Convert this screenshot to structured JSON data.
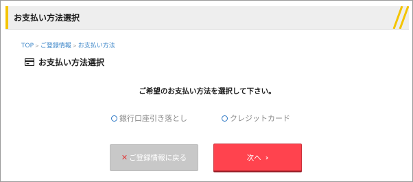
{
  "header": {
    "title": "お支払い方法選択"
  },
  "breadcrumb": {
    "items": [
      "TOP",
      "ご登録情報",
      "お支払い方法"
    ],
    "separator": ">"
  },
  "section": {
    "title": "お支払い方法選択",
    "icon": "credit-card-icon"
  },
  "instruction": "ご希望のお支払い方法を選択して下さい。",
  "payment_options": [
    {
      "label": "銀行口座引き落とし",
      "selected": false
    },
    {
      "label": "クレジットカード",
      "selected": false
    }
  ],
  "buttons": {
    "back": {
      "label": "ご登録情報に戻る",
      "icon": "x-icon"
    },
    "next": {
      "label": "次へ",
      "icon": "chevron-right-icon"
    }
  },
  "colors": {
    "accent": "#f4c400",
    "link": "#3c86c8",
    "next_button": "#ff434e",
    "back_button": "#c8c8c8",
    "radio_border": "#2f79c5"
  }
}
